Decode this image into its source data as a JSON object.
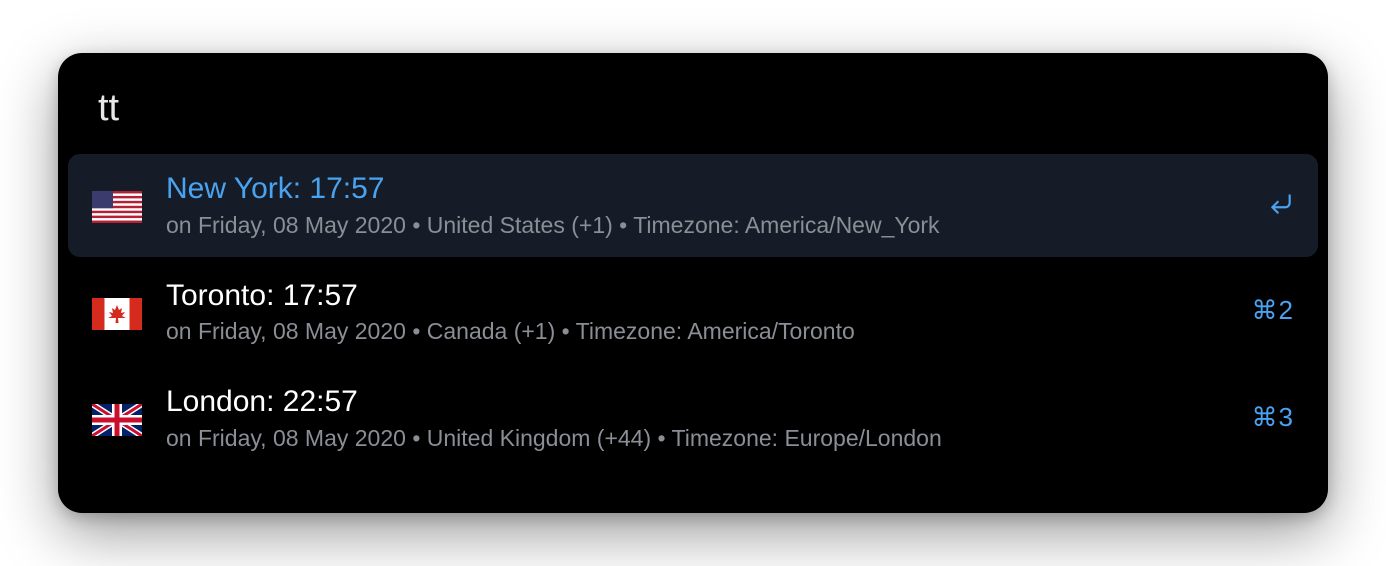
{
  "search": {
    "value": "tt"
  },
  "results": [
    {
      "flag": "us",
      "title": "New York: 17:57",
      "subtitle": "on Friday, 08 May 2020 • United States (+1) • Timezone: America/New_York",
      "shortcut_type": "enter",
      "shortcut_text": "",
      "selected": true
    },
    {
      "flag": "ca",
      "title": "Toronto: 17:57",
      "subtitle": "on Friday, 08 May 2020 • Canada (+1) • Timezone: America/Toronto",
      "shortcut_type": "cmd",
      "shortcut_text": "⌘2",
      "selected": false
    },
    {
      "flag": "gb",
      "title": "London: 22:57",
      "subtitle": "on Friday, 08 May 2020 • United Kingdom (+44) • Timezone: Europe/London",
      "shortcut_type": "cmd",
      "shortcut_text": "⌘3",
      "selected": false
    }
  ]
}
